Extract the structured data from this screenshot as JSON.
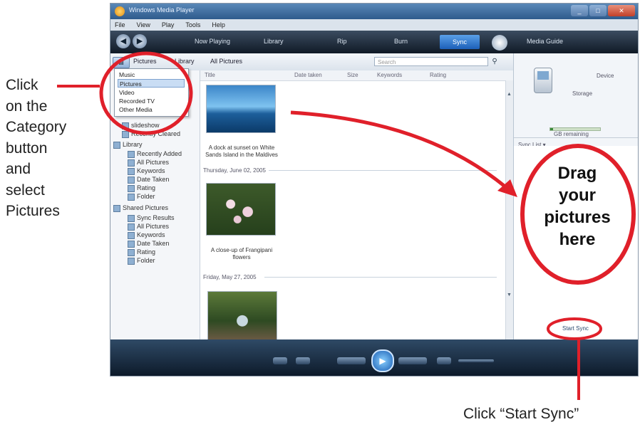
{
  "annotations": {
    "category_note_lines": [
      "Click",
      "on the",
      "Category",
      "button",
      "and",
      "select",
      "Pictures"
    ],
    "drag_note_lines": [
      "Drag",
      "your",
      "pictures",
      "here"
    ],
    "sync_note": "Click “Start Sync”",
    "accent_color": "#e0202a"
  },
  "window": {
    "title": "Windows Media Player",
    "buttons": [
      "_",
      "□",
      "✕"
    ],
    "menu": [
      "File",
      "View",
      "Play",
      "Tools",
      "Help"
    ],
    "nav_tabs": [
      "Now Playing",
      "Library",
      "Rip",
      "Burn",
      "Sync",
      "Media Guide"
    ],
    "active_tab": "Sync"
  },
  "toolbar": {
    "category_button": "▤",
    "breadcrumb": [
      "Pictures",
      "Library",
      "All Pictures"
    ],
    "search_placeholder": "Search",
    "search_icon": "search-icon"
  },
  "category_menu": {
    "items": [
      "Music",
      "Pictures",
      "Video",
      "Recorded TV",
      "Other Media"
    ],
    "selected": "Pictures"
  },
  "tree": {
    "items": [
      "slideshow",
      "Recently Cleared",
      "Library",
      "Recently Added",
      "All Pictures",
      "Keywords",
      "Date Taken",
      "Rating",
      "Folder",
      "Shared Pictures",
      "Sync Results",
      "All Pictures",
      "Keywords",
      "Date Taken",
      "Rating",
      "Folder"
    ]
  },
  "content": {
    "columns": [
      "Title",
      "Date taken",
      "Size",
      "Keywords",
      "Rating"
    ],
    "groups": [
      {
        "header": "",
        "caption": "A dock at sunset on White Sands Island in the Maldives"
      },
      {
        "header": "Thursday, June 02, 2005",
        "caption": "A close-up of Frangipani flowers"
      },
      {
        "header": "Friday, May 27, 2005",
        "caption": ""
      }
    ]
  },
  "sync_pane": {
    "device_name": "Device",
    "storage_text": "Storage",
    "remaining_text": "GB remaining",
    "list_label": "Sync List ▾",
    "start_sync": "Start Sync",
    "capacity_used_fraction": 0.05
  },
  "player": {
    "play_icon": "▶"
  }
}
